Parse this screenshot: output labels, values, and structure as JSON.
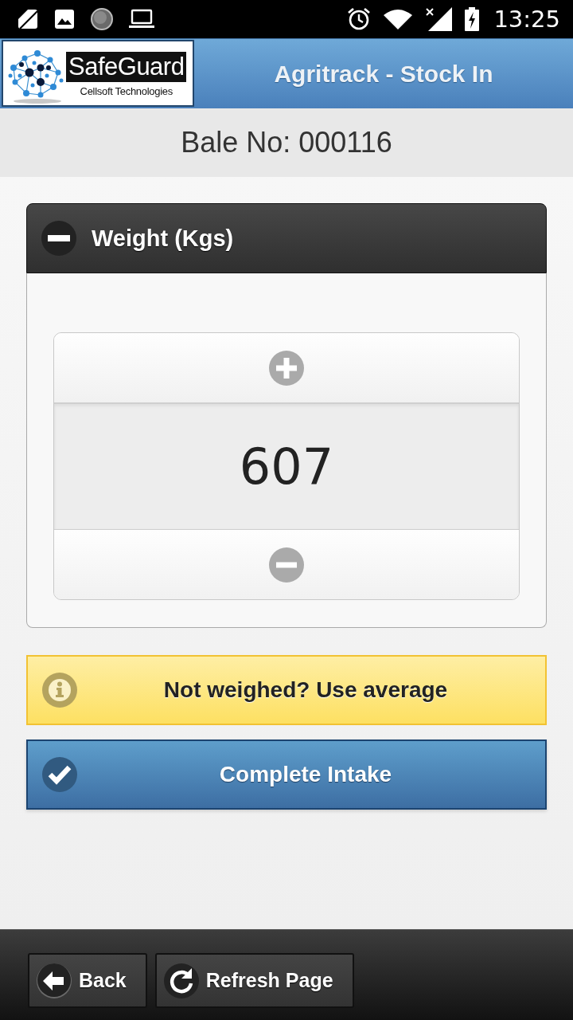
{
  "status_bar": {
    "time": "13:25"
  },
  "header": {
    "logo": {
      "name": "SafeGuard",
      "tagline": "Cellsoft Technologies"
    },
    "title": "Agritrack - Stock In"
  },
  "bale": {
    "label": "Bale No: 000116"
  },
  "weight_panel": {
    "title": "Weight (Kgs)",
    "expanded": true,
    "value": "607"
  },
  "buttons": [
    {
      "kind": "warning",
      "label": "Not weighed? Use average"
    },
    {
      "kind": "primary",
      "label": "Complete Intake"
    }
  ],
  "footer": {
    "buttons": [
      {
        "kind": "back",
        "label": "Back"
      },
      {
        "kind": "refresh",
        "label": "Refresh Page"
      }
    ]
  }
}
